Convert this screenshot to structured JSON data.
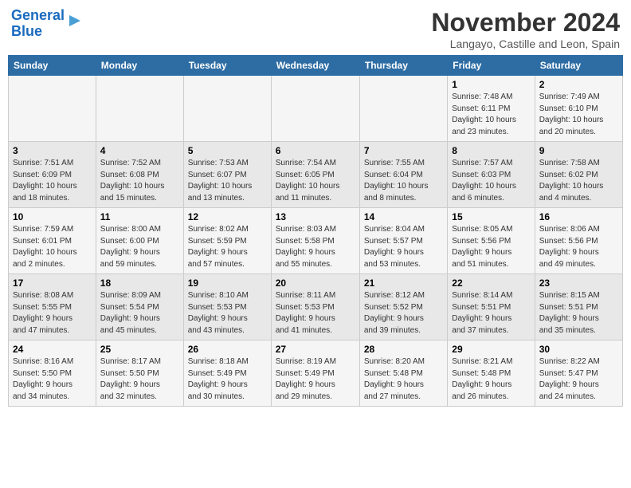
{
  "logo": {
    "line1": "General",
    "line2": "Blue"
  },
  "title": "November 2024",
  "location": "Langayo, Castille and Leon, Spain",
  "days_header": [
    "Sunday",
    "Monday",
    "Tuesday",
    "Wednesday",
    "Thursday",
    "Friday",
    "Saturday"
  ],
  "weeks": [
    [
      {
        "day": "",
        "info": ""
      },
      {
        "day": "",
        "info": ""
      },
      {
        "day": "",
        "info": ""
      },
      {
        "day": "",
        "info": ""
      },
      {
        "day": "",
        "info": ""
      },
      {
        "day": "1",
        "info": "Sunrise: 7:48 AM\nSunset: 6:11 PM\nDaylight: 10 hours\nand 23 minutes."
      },
      {
        "day": "2",
        "info": "Sunrise: 7:49 AM\nSunset: 6:10 PM\nDaylight: 10 hours\nand 20 minutes."
      }
    ],
    [
      {
        "day": "3",
        "info": "Sunrise: 7:51 AM\nSunset: 6:09 PM\nDaylight: 10 hours\nand 18 minutes."
      },
      {
        "day": "4",
        "info": "Sunrise: 7:52 AM\nSunset: 6:08 PM\nDaylight: 10 hours\nand 15 minutes."
      },
      {
        "day": "5",
        "info": "Sunrise: 7:53 AM\nSunset: 6:07 PM\nDaylight: 10 hours\nand 13 minutes."
      },
      {
        "day": "6",
        "info": "Sunrise: 7:54 AM\nSunset: 6:05 PM\nDaylight: 10 hours\nand 11 minutes."
      },
      {
        "day": "7",
        "info": "Sunrise: 7:55 AM\nSunset: 6:04 PM\nDaylight: 10 hours\nand 8 minutes."
      },
      {
        "day": "8",
        "info": "Sunrise: 7:57 AM\nSunset: 6:03 PM\nDaylight: 10 hours\nand 6 minutes."
      },
      {
        "day": "9",
        "info": "Sunrise: 7:58 AM\nSunset: 6:02 PM\nDaylight: 10 hours\nand 4 minutes."
      }
    ],
    [
      {
        "day": "10",
        "info": "Sunrise: 7:59 AM\nSunset: 6:01 PM\nDaylight: 10 hours\nand 2 minutes."
      },
      {
        "day": "11",
        "info": "Sunrise: 8:00 AM\nSunset: 6:00 PM\nDaylight: 9 hours\nand 59 minutes."
      },
      {
        "day": "12",
        "info": "Sunrise: 8:02 AM\nSunset: 5:59 PM\nDaylight: 9 hours\nand 57 minutes."
      },
      {
        "day": "13",
        "info": "Sunrise: 8:03 AM\nSunset: 5:58 PM\nDaylight: 9 hours\nand 55 minutes."
      },
      {
        "day": "14",
        "info": "Sunrise: 8:04 AM\nSunset: 5:57 PM\nDaylight: 9 hours\nand 53 minutes."
      },
      {
        "day": "15",
        "info": "Sunrise: 8:05 AM\nSunset: 5:56 PM\nDaylight: 9 hours\nand 51 minutes."
      },
      {
        "day": "16",
        "info": "Sunrise: 8:06 AM\nSunset: 5:56 PM\nDaylight: 9 hours\nand 49 minutes."
      }
    ],
    [
      {
        "day": "17",
        "info": "Sunrise: 8:08 AM\nSunset: 5:55 PM\nDaylight: 9 hours\nand 47 minutes."
      },
      {
        "day": "18",
        "info": "Sunrise: 8:09 AM\nSunset: 5:54 PM\nDaylight: 9 hours\nand 45 minutes."
      },
      {
        "day": "19",
        "info": "Sunrise: 8:10 AM\nSunset: 5:53 PM\nDaylight: 9 hours\nand 43 minutes."
      },
      {
        "day": "20",
        "info": "Sunrise: 8:11 AM\nSunset: 5:53 PM\nDaylight: 9 hours\nand 41 minutes."
      },
      {
        "day": "21",
        "info": "Sunrise: 8:12 AM\nSunset: 5:52 PM\nDaylight: 9 hours\nand 39 minutes."
      },
      {
        "day": "22",
        "info": "Sunrise: 8:14 AM\nSunset: 5:51 PM\nDaylight: 9 hours\nand 37 minutes."
      },
      {
        "day": "23",
        "info": "Sunrise: 8:15 AM\nSunset: 5:51 PM\nDaylight: 9 hours\nand 35 minutes."
      }
    ],
    [
      {
        "day": "24",
        "info": "Sunrise: 8:16 AM\nSunset: 5:50 PM\nDaylight: 9 hours\nand 34 minutes."
      },
      {
        "day": "25",
        "info": "Sunrise: 8:17 AM\nSunset: 5:50 PM\nDaylight: 9 hours\nand 32 minutes."
      },
      {
        "day": "26",
        "info": "Sunrise: 8:18 AM\nSunset: 5:49 PM\nDaylight: 9 hours\nand 30 minutes."
      },
      {
        "day": "27",
        "info": "Sunrise: 8:19 AM\nSunset: 5:49 PM\nDaylight: 9 hours\nand 29 minutes."
      },
      {
        "day": "28",
        "info": "Sunrise: 8:20 AM\nSunset: 5:48 PM\nDaylight: 9 hours\nand 27 minutes."
      },
      {
        "day": "29",
        "info": "Sunrise: 8:21 AM\nSunset: 5:48 PM\nDaylight: 9 hours\nand 26 minutes."
      },
      {
        "day": "30",
        "info": "Sunrise: 8:22 AM\nSunset: 5:47 PM\nDaylight: 9 hours\nand 24 minutes."
      }
    ]
  ]
}
